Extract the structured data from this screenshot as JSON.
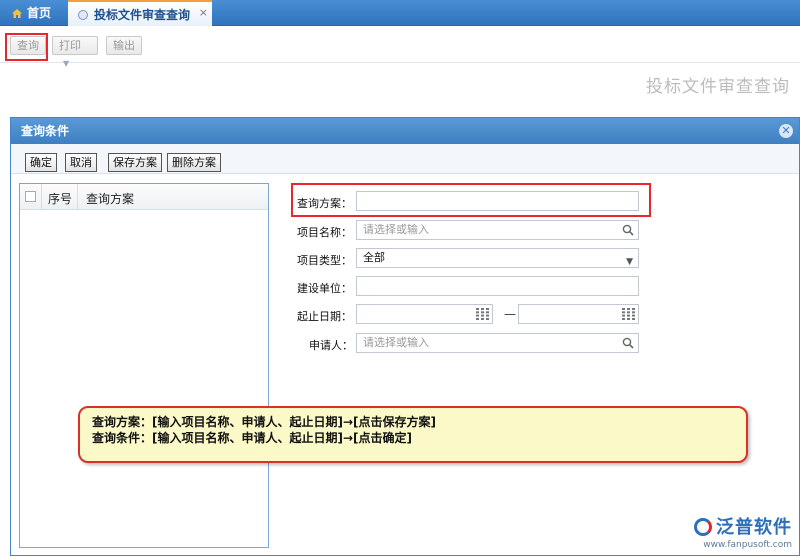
{
  "tabs": {
    "home_label": "首页",
    "active_label": "投标文件审查查询",
    "close_glyph": "×"
  },
  "toolbar": {
    "query_label": "查询",
    "print_label": "打印",
    "export_label": "输出"
  },
  "page_title": "投标文件审查查询",
  "dialog": {
    "title": "查询条件",
    "close_glyph": "✕",
    "buttons": {
      "ok": "确定",
      "cancel": "取消",
      "save_scheme": "保存方案",
      "delete_scheme": "删除方案"
    },
    "list": {
      "col_seq": "序号",
      "col_name": "查询方案"
    },
    "form": {
      "scheme_label": "查询方案：",
      "scheme_value": "",
      "project_name_label": "项目名称：",
      "project_name_placeholder": "请选择或输入",
      "project_type_label": "项目类型：",
      "project_type_value": "全部",
      "builder_label": "建设单位：",
      "builder_value": "",
      "date_label": "起止日期：",
      "date_from": "",
      "date_to": "",
      "date_sep": "—",
      "applicant_label": "申请人：",
      "applicant_placeholder": "请选择或输入"
    }
  },
  "callout": {
    "line1": "查询方案：[输入项目名称、申请人、起止日期]→[点击保存方案]",
    "line2": "查询条件：[输入项目名称、申请人、起止日期]→[点击确定]"
  },
  "brand": {
    "name": "泛普软件",
    "url": "www.fanpusoft.com"
  },
  "colors": {
    "header_blue": "#3e7fc2",
    "highlight_red": "#e8262c",
    "callout_bg": "#fbf9c8"
  }
}
